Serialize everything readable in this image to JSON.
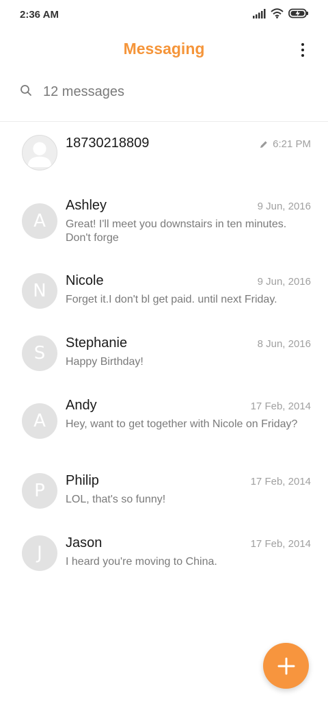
{
  "status_bar": {
    "time": "2:36 AM",
    "icons": [
      "signal-icon",
      "wifi-icon",
      "battery-charging-icon"
    ]
  },
  "header": {
    "title": "Messaging",
    "menu_icon": "more-vertical-icon",
    "accent_color": "#f5953a"
  },
  "search": {
    "icon": "search-icon",
    "text": "12 messages"
  },
  "conversations": [
    {
      "name": "18730218809",
      "avatar": "person-icon",
      "date": "6:21 PM",
      "draft_icon": "pencil-icon",
      "preview": ""
    },
    {
      "name": "Ashley",
      "avatar": "A",
      "date": "9 Jun, 2016",
      "preview": "Great! I'll meet you downstairs in ten minutes. Don't forge"
    },
    {
      "name": "Nicole",
      "avatar": "N",
      "date": "9 Jun, 2016",
      "preview": "Forget it.I don't bl get paid. until next Friday."
    },
    {
      "name": "Stephanie",
      "avatar": "S",
      "date": "8 Jun, 2016",
      "preview": "Happy Birthday!"
    },
    {
      "name": "Andy",
      "avatar": "A",
      "date": "17 Feb, 2014",
      "preview": "Hey, want to get together with Nicole on Friday?"
    },
    {
      "name": "Philip",
      "avatar": "P",
      "date": "17 Feb, 2014",
      "preview": "LOL, that's so funny!"
    },
    {
      "name": "Jason",
      "avatar": "J",
      "date": "17 Feb, 2014",
      "preview": "I heard you're moving to China."
    }
  ],
  "fab": {
    "icon": "plus-icon",
    "color": "#f7953e"
  }
}
